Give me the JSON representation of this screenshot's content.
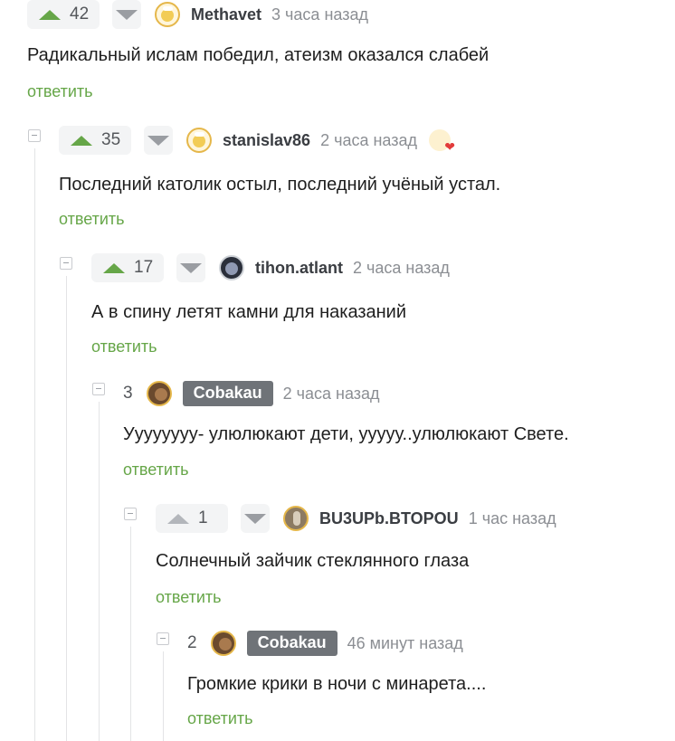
{
  "reply_label": "ответить",
  "colors": {
    "accent": "#66a648",
    "badge_bg": "#6f7378",
    "text": "#1e1e1e",
    "muted": "#8b8e93"
  },
  "comments": [
    {
      "rating": "42",
      "author": "Methavet",
      "time": "3 часа назад",
      "text": "Радикальный ислам победил, атеизм оказался слабей",
      "avatar_icon": "beer-mug-avatar-icon"
    },
    {
      "rating": "35",
      "author": "stanislav86",
      "time": "2 часа назад",
      "text": "Последний католик остыл, последний учёный устал.",
      "avatar_icon": "beer-mug-avatar-icon",
      "award_icon": "heart-award-icon"
    },
    {
      "rating": "17",
      "author": "tihon.atlant",
      "time": "2 часа назад",
      "text": "А в спину летят камни для наказаний",
      "avatar_icon": "dark-portrait-avatar-icon"
    },
    {
      "rating": "3",
      "author": "Cobakau",
      "time": "2 часа назад",
      "text": "Уууууууу- улюлюкают дети, ууууу..улюлюкают Свете.",
      "avatar_icon": "dog-avatar-icon"
    },
    {
      "rating": "1",
      "author": "BU3UPb.BTOPOU",
      "time": "1 час назад",
      "text": "Солнечный зайчик стеклянного глаза",
      "avatar_icon": "feather-avatar-icon"
    },
    {
      "rating": "2",
      "author": "Cobakau",
      "time": "46 минут назад",
      "text": "Громкие крики в ночи с минарета....",
      "avatar_icon": "dog-avatar-icon"
    }
  ]
}
